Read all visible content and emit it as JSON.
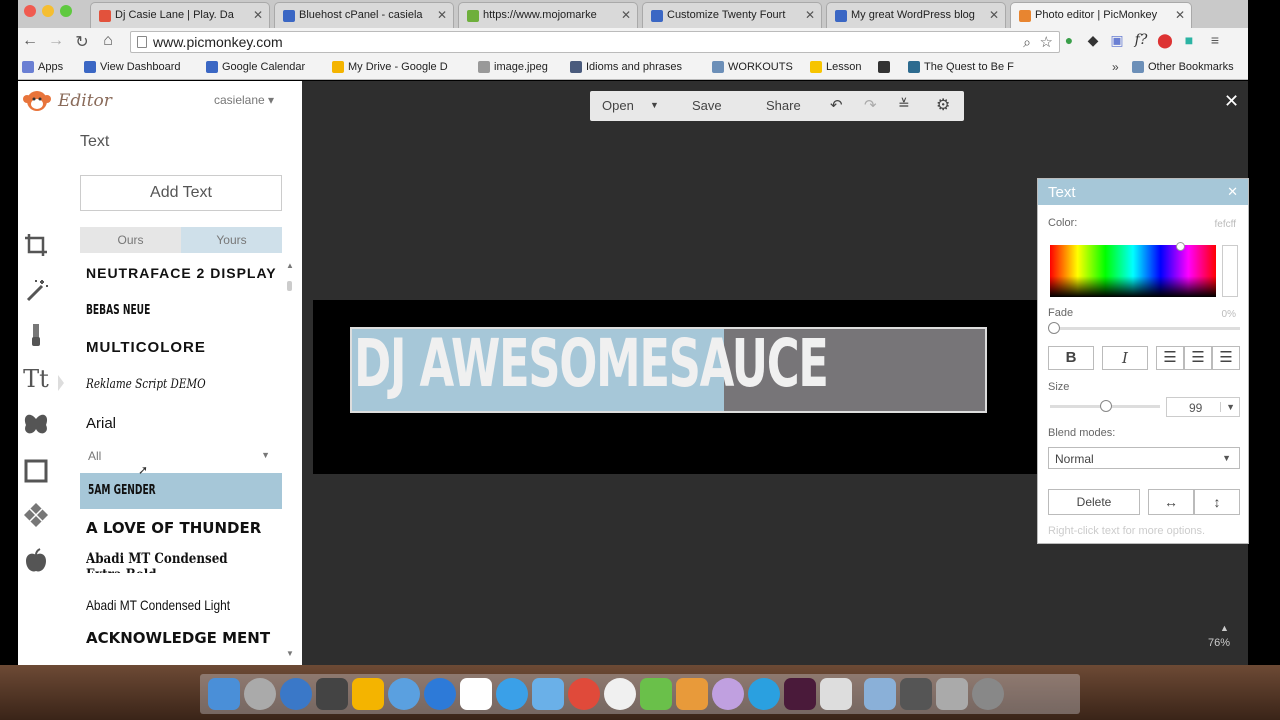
{
  "browser": {
    "tabs": [
      {
        "title": "Dj Casie Lane | Play. Da",
        "color": "#e2523c"
      },
      {
        "title": "Bluehost cPanel - casiela",
        "color": "#3b67c4"
      },
      {
        "title": "https://www.mojomarke",
        "color": "#6eaf3c"
      },
      {
        "title": "Customize Twenty Fourt",
        "color": "#3b67c4"
      },
      {
        "title": "My great WordPress blog",
        "color": "#3b67c4"
      },
      {
        "title": "Photo editor | PicMonkey",
        "color": "#e88530"
      }
    ],
    "url": "www.picmonkey.com",
    "bookmarks": [
      {
        "label": "Apps",
        "color": "#6a7fd3"
      },
      {
        "label": "View Dashboard",
        "color": "#3b67c4"
      },
      {
        "label": "Google Calendar",
        "color": "#3b67c4"
      },
      {
        "label": "My Drive - Google D",
        "color": "#f4b400"
      },
      {
        "label": "image.jpeg",
        "color": "#999999"
      },
      {
        "label": "Idioms and phrases",
        "color": "#4a5b7d"
      },
      {
        "label": "WORKOUTS",
        "color": "#6c8fb8"
      },
      {
        "label": "Lesson",
        "color": "#f7c400"
      },
      {
        "label": "",
        "color": "#333333"
      },
      {
        "label": "The Quest to Be F",
        "color": "#2d6b8f"
      },
      {
        "label": "Other Bookmarks",
        "color": "#6c8fb8"
      }
    ]
  },
  "editor": {
    "title": "Editor",
    "user": "casielane ▾",
    "panel_title": "Text",
    "add_text": "Add Text",
    "tabs": {
      "ours": "Ours",
      "yours": "Yours"
    },
    "fonts": [
      "NEUTRAFACE 2 DISPLAY",
      "BEBAS NEUE",
      "MULTICOLORE",
      "Reklame Script DEMO",
      "Arial"
    ],
    "filter": "All",
    "selected_font": "5AM GENDER",
    "more_fonts": [
      "A LOVE OF THUNDER",
      "Abadi MT Condensed Extra Bold",
      "Abadi MT Condensed Light",
      "ACKNOWLEDGE MENT"
    ]
  },
  "toolbar": {
    "open": "Open",
    "save": "Save",
    "share": "Share"
  },
  "canvas": {
    "text": "DJ AWESOMESAUCE",
    "zoom": "76%"
  },
  "text_panel": {
    "title": "Text",
    "color_label": "Color:",
    "color_value": "fefcff",
    "fade_label": "Fade",
    "fade_value": "0%",
    "bold": "B",
    "italic": "I",
    "size_label": "Size",
    "size_value": "99",
    "blend_label": "Blend modes:",
    "blend_value": "Normal",
    "delete": "Delete",
    "hint": "Right-click text for more options."
  },
  "colors": {
    "accent": "#a6c7d8",
    "workspace": "#2e2e2e"
  }
}
